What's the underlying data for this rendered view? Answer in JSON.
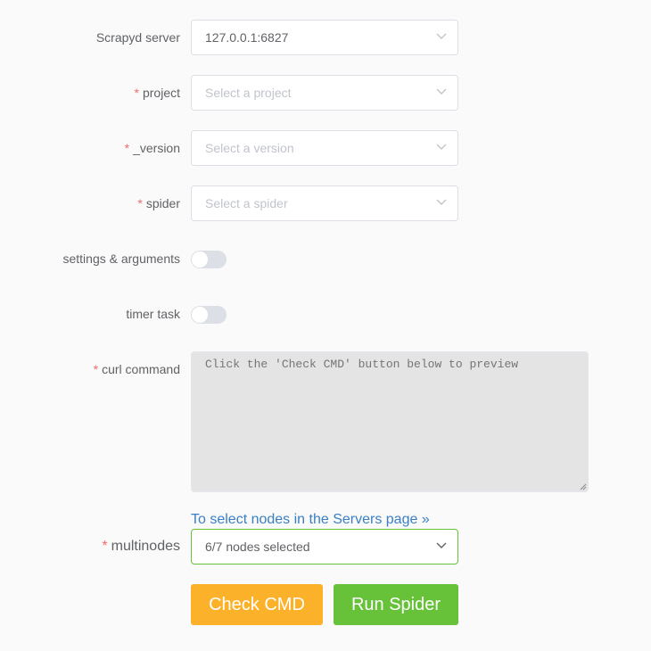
{
  "form": {
    "server": {
      "label": "Scrapyd server",
      "value": "127.0.0.1:6827"
    },
    "project": {
      "label": "project",
      "placeholder": "Select a project"
    },
    "version": {
      "label": "_version",
      "placeholder": "Select a version"
    },
    "spider": {
      "label": "spider",
      "placeholder": "Select a spider"
    },
    "settings": {
      "label": "settings & arguments",
      "enabled": false
    },
    "timer": {
      "label": "timer task",
      "enabled": false
    },
    "curl": {
      "label": "curl command",
      "placeholder": "Click the 'Check CMD' button below to preview"
    },
    "nodes_link": "To select nodes in the Servers page »",
    "multinodes": {
      "label": "multinodes",
      "value": "6/7 nodes selected"
    },
    "required_mark": "*"
  },
  "buttons": {
    "check_cmd": "Check CMD",
    "run_spider": "Run Spider"
  },
  "colors": {
    "required": "#f56c6c",
    "link": "#3a7fc4",
    "check_cmd": "#fbb22a",
    "run_spider": "#67c23a",
    "multinodes_border": "#67c23a"
  },
  "icons": {
    "dropdown": "chevron-down-icon",
    "resize": "resize-grip-icon"
  }
}
